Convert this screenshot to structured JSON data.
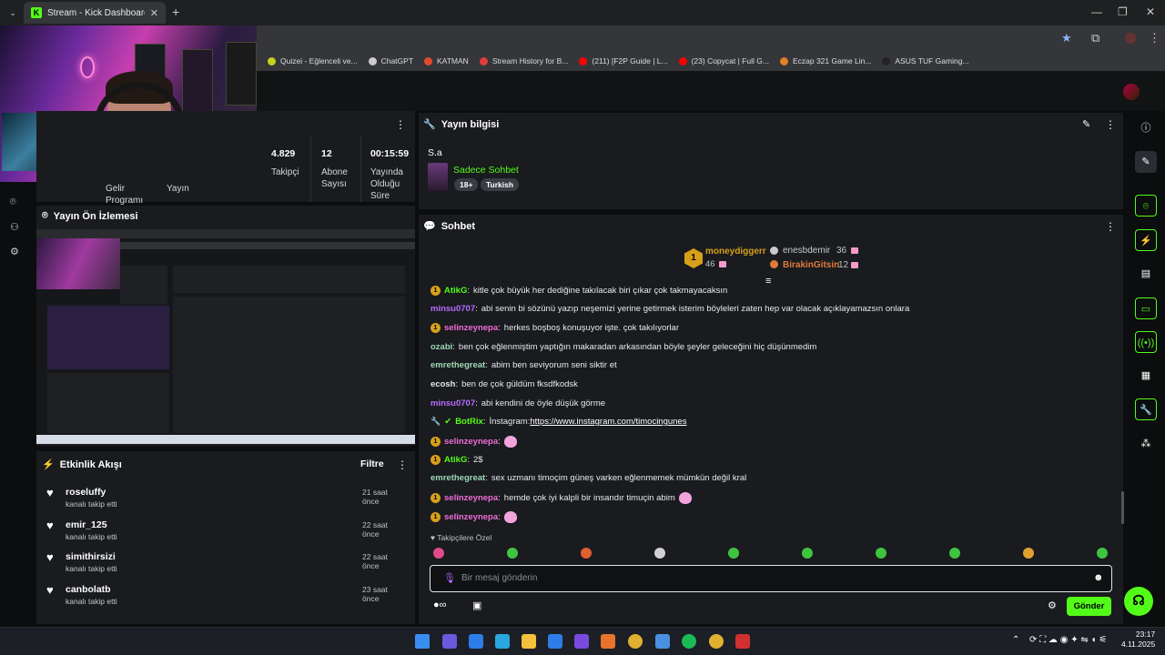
{
  "browser": {
    "tab_title": "Stream - Kick Dashboard",
    "tab_icon_letter": "K",
    "bookmarks": [
      {
        "label": "Quizei - Eğlenceli ve...",
        "color": "#c7d01c"
      },
      {
        "label": "ChatGPT",
        "color": "#cccccc"
      },
      {
        "label": "KATMAN",
        "color": "#e34b2c"
      },
      {
        "label": "Stream History for B...",
        "color": "#e23d3d"
      },
      {
        "label": "(211) [F2P Guide | L...",
        "color": "#ff0000"
      },
      {
        "label": "(23) Copycat | Full G...",
        "color": "#ff0000"
      },
      {
        "label": "Eczap 321 Game Lin...",
        "color": "#e57e24"
      },
      {
        "label": "ASUS TUF Gaming...",
        "color": "#222222"
      }
    ]
  },
  "stats": {
    "items": [
      {
        "value": "",
        "label": "Gelir Programı"
      },
      {
        "value": "",
        "label": "Yayın"
      },
      {
        "value": "4.829",
        "label": "Takipçi"
      },
      {
        "value": "12",
        "label": "Abone Sayısı"
      },
      {
        "value": "00:15:59",
        "label": "Yayında Olduğu Süre"
      }
    ]
  },
  "preview": {
    "title": "Yayın Ön İzlemesi"
  },
  "events": {
    "title": "Etkinlik Akışı",
    "filter_label": "Filtre",
    "items": [
      {
        "name": "roseluffy",
        "action": "kanalı takip etti",
        "time": "21 saat önce"
      },
      {
        "name": "emir_125",
        "action": "kanalı takip etti",
        "time": "22 saat önce"
      },
      {
        "name": "simithirsizi",
        "action": "kanalı takip etti",
        "time": "22 saat önce"
      },
      {
        "name": "canbolatb",
        "action": "kanalı takip etti",
        "time": "23 saat önce"
      }
    ]
  },
  "stream_info": {
    "title": "Yayın bilgisi",
    "stream_title": "S.a",
    "category": "Sadece Sohbet",
    "tags": [
      "18+",
      "Turkish"
    ]
  },
  "chat": {
    "title": "Sohbet",
    "leaderboard": {
      "first": {
        "rank": "1",
        "name": "moneydiggerr",
        "count": "46"
      },
      "second": {
        "name": "enesbdemir",
        "count": "36"
      },
      "third": {
        "name": "BirakinGitsin",
        "count": "12"
      }
    },
    "messages": [
      {
        "badge": true,
        "user": "AtikG",
        "color": "u-green",
        "text": "kitle çok büyük her dediğine takılacak biri çıkar çok takmayacaksın"
      },
      {
        "badge": false,
        "user": "minsu0707",
        "color": "u-purple",
        "text": "abi senin bi sözünü yazıp neşemizi yerine getirmek isterim böyleleri zaten hep var olacak açıklayamazsın onlara"
      },
      {
        "badge": true,
        "user": "selinzeynepa",
        "color": "u-pink",
        "text": "herkes boşboş konuşuyor işte. çok takılıyorlar"
      },
      {
        "badge": false,
        "user": "ozabi",
        "color": "u-ltg",
        "text": "ben çok eğlenmiştim yaptığın makaradan arkasından böyle şeyler geleceğini hiç düşünmedim"
      },
      {
        "badge": false,
        "user": "emrethegreat",
        "color": "u-ltg",
        "text": "abim ben seviyorum seni siktir et"
      },
      {
        "badge": false,
        "user": "ecosh",
        "color": "u-white",
        "text": "ben de çok güldüm fksdfkodsk"
      },
      {
        "badge": false,
        "user": "minsu0707",
        "color": "u-purple",
        "text": "abi kendini de öyle düşük görme"
      },
      {
        "badge": false,
        "user": "BotRix",
        "color": "u-green",
        "text": "İnstagram: ",
        "link": "https://www.instagram.com/timocingunes"
      },
      {
        "badge": true,
        "user": "selinzeynepa",
        "color": "u-pink",
        "text": "",
        "emote": true
      },
      {
        "badge": true,
        "user": "AtikG",
        "color": "u-green",
        "text": "2$"
      },
      {
        "badge": false,
        "user": "emrethegreat",
        "color": "u-ltg",
        "text": "sex uzmanı timoçim güneş varken eğlenmemek mümkün değil kral"
      },
      {
        "badge": true,
        "user": "selinzeynepa",
        "color": "u-pink",
        "text": "hemde çok iyi kalpli bir insandır timuçin abim",
        "emote_after": true
      },
      {
        "badge": true,
        "user": "selinzeynepa",
        "color": "u-pink",
        "text": "",
        "emote": true
      }
    ],
    "followers_only_label": "Takipçilere Özel",
    "input_placeholder": "Bir mesaj gönderin",
    "send_label": "Gönder"
  },
  "taskbar": {
    "time": "23:17",
    "date": "4.11.2025"
  },
  "colors": {
    "accent": "#53fc18",
    "panel": "#191b1f",
    "background": "#0b0d0e"
  }
}
